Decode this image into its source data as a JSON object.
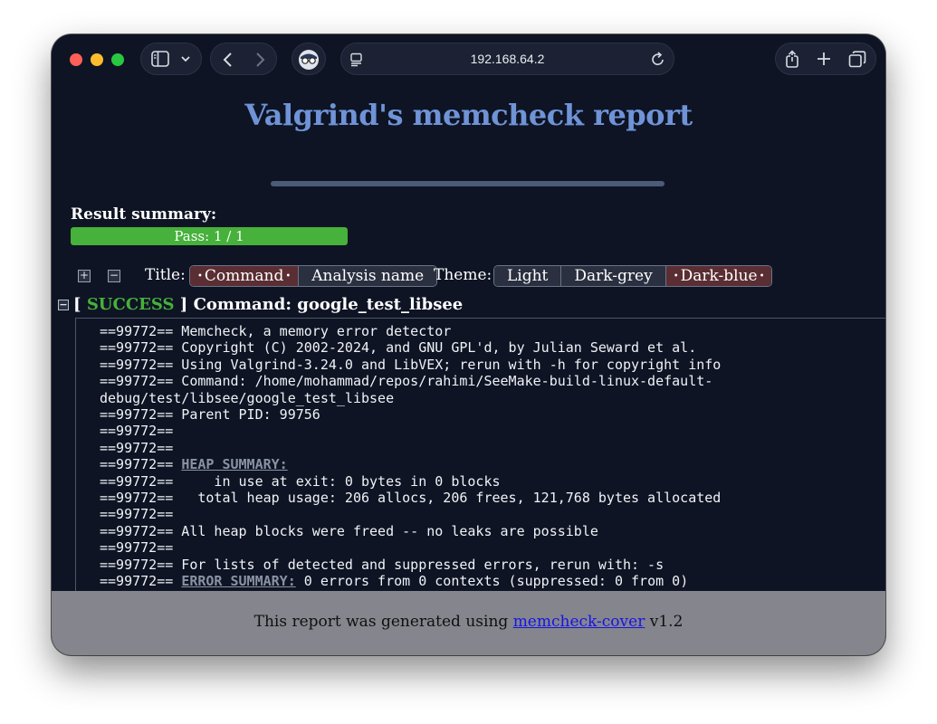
{
  "browser": {
    "address": "192.168.64.2"
  },
  "report": {
    "title": "Valgrind's memcheck report",
    "summary_label": "Result summary:",
    "progress": {
      "text": "Pass: 1 / 1",
      "fraction": 1.0
    },
    "controls": {
      "title_label": "Title:",
      "title_options": [
        "Command",
        "Analysis name"
      ],
      "title_selected": "Command",
      "theme_label": "Theme:",
      "theme_options": [
        "Light",
        "Dark-grey",
        "Dark-blue"
      ],
      "theme_selected": "Dark-blue"
    },
    "command": {
      "status": "SUCCESS",
      "bracket_open": "[",
      "bracket_close": "]",
      "text": "Command: google_test_libsee"
    },
    "log_lines": [
      "==99772== Memcheck, a memory error detector",
      "==99772== Copyright (C) 2002-2024, and GNU GPL'd, by Julian Seward et al.",
      "==99772== Using Valgrind-3.24.0 and LibVEX; rerun with -h for copyright info",
      "==99772== Command: /home/mohammad/repos/rahimi/SeeMake-build-linux-default-",
      "debug/test/libsee/google_test_libsee",
      "==99772== Parent PID: 99756",
      "==99772==",
      "==99772==",
      "==99772== HEAP SUMMARY:",
      "==99772==     in use at exit: 0 bytes in 0 blocks",
      "==99772==   total heap usage: 206 allocs, 206 frees, 121,768 bytes allocated",
      "==99772==",
      "==99772== All heap blocks were freed -- no leaks are possible",
      "==99772==",
      "==99772== For lists of detected and suppressed errors, rerun with: -s",
      "==99772== ERROR SUMMARY: 0 errors from 0 contexts (suppressed: 0 from 0)"
    ],
    "highlight_terms": [
      "HEAP SUMMARY:",
      "ERROR SUMMARY:"
    ],
    "footer": {
      "prefix": "This report was generated using ",
      "link_text": "memcheck-cover",
      "suffix": " v1.2"
    }
  }
}
